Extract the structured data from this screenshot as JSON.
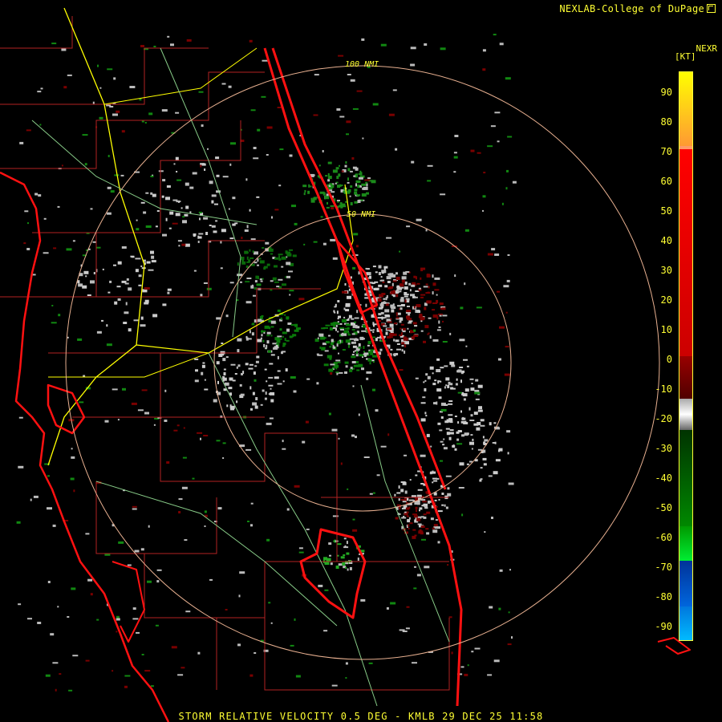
{
  "header": {
    "credit": "NEXLAB-College of DuPage",
    "product": "NEXR",
    "units": "[KT]"
  },
  "footer": {
    "caption": "STORM RELATIVE VELOCITY 0.5 DEG - KMLB 29 DEC 25 11:58"
  },
  "range_rings": {
    "outer_label": "100 NMI",
    "inner_label": "50 NMI"
  },
  "legend": {
    "ticks": [
      "90",
      "80",
      "70",
      "60",
      "50",
      "40",
      "30",
      "20",
      "10",
      "0",
      "-10",
      "-20",
      "-30",
      "-40",
      "-50",
      "-60",
      "-70",
      "-80",
      "-90"
    ],
    "colors": {
      "top": "#ffff00",
      "orange": "#ff9966",
      "red": "#ff0000",
      "dark_red": "#800000",
      "gray": "#c8c8c8",
      "dark_green": "#006400",
      "green": "#00dd22",
      "blue": "#0055cc",
      "cyan": "#00aaff"
    }
  },
  "map": {
    "county_line_color": "#b22222",
    "road_color": "#ffff00",
    "minor_road_color": "#88cc88",
    "coast_color": "#ff1111",
    "ring_color": "#e8b090"
  }
}
